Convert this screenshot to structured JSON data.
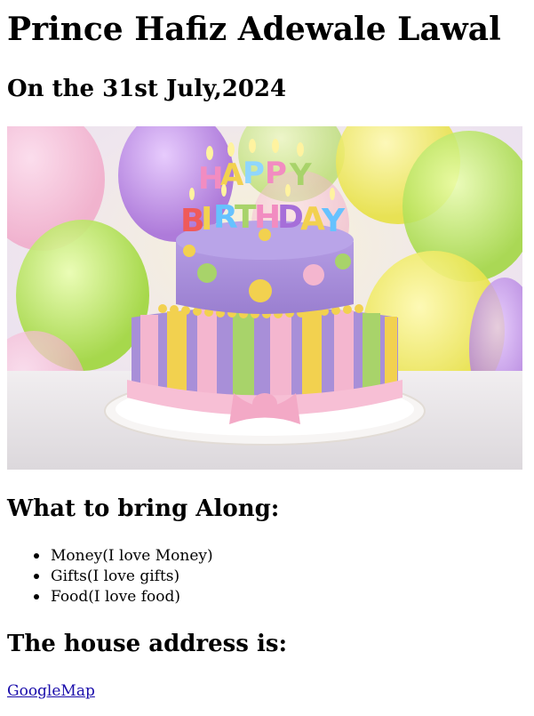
{
  "page": {
    "title": "Prince Hafiz Adewale Lawal",
    "date_heading": "On the 31st July,2024"
  },
  "image": {
    "subject": "birthday cake",
    "topper_text": "HAPPY BIRTHDAY"
  },
  "bring": {
    "heading": "What to bring Along:",
    "items": [
      "Money(I love Money)",
      "Gifts(I love gifts)",
      "Food(I love food)"
    ]
  },
  "address": {
    "heading": "The house address is:",
    "link_label": "GoogleMap"
  },
  "colors": {
    "link": "#1a0dab",
    "cake_purple": "#a88fd8",
    "cake_pink": "#f4b6cf",
    "cake_yellow": "#f2d14f",
    "cake_green": "#a8d36a"
  }
}
